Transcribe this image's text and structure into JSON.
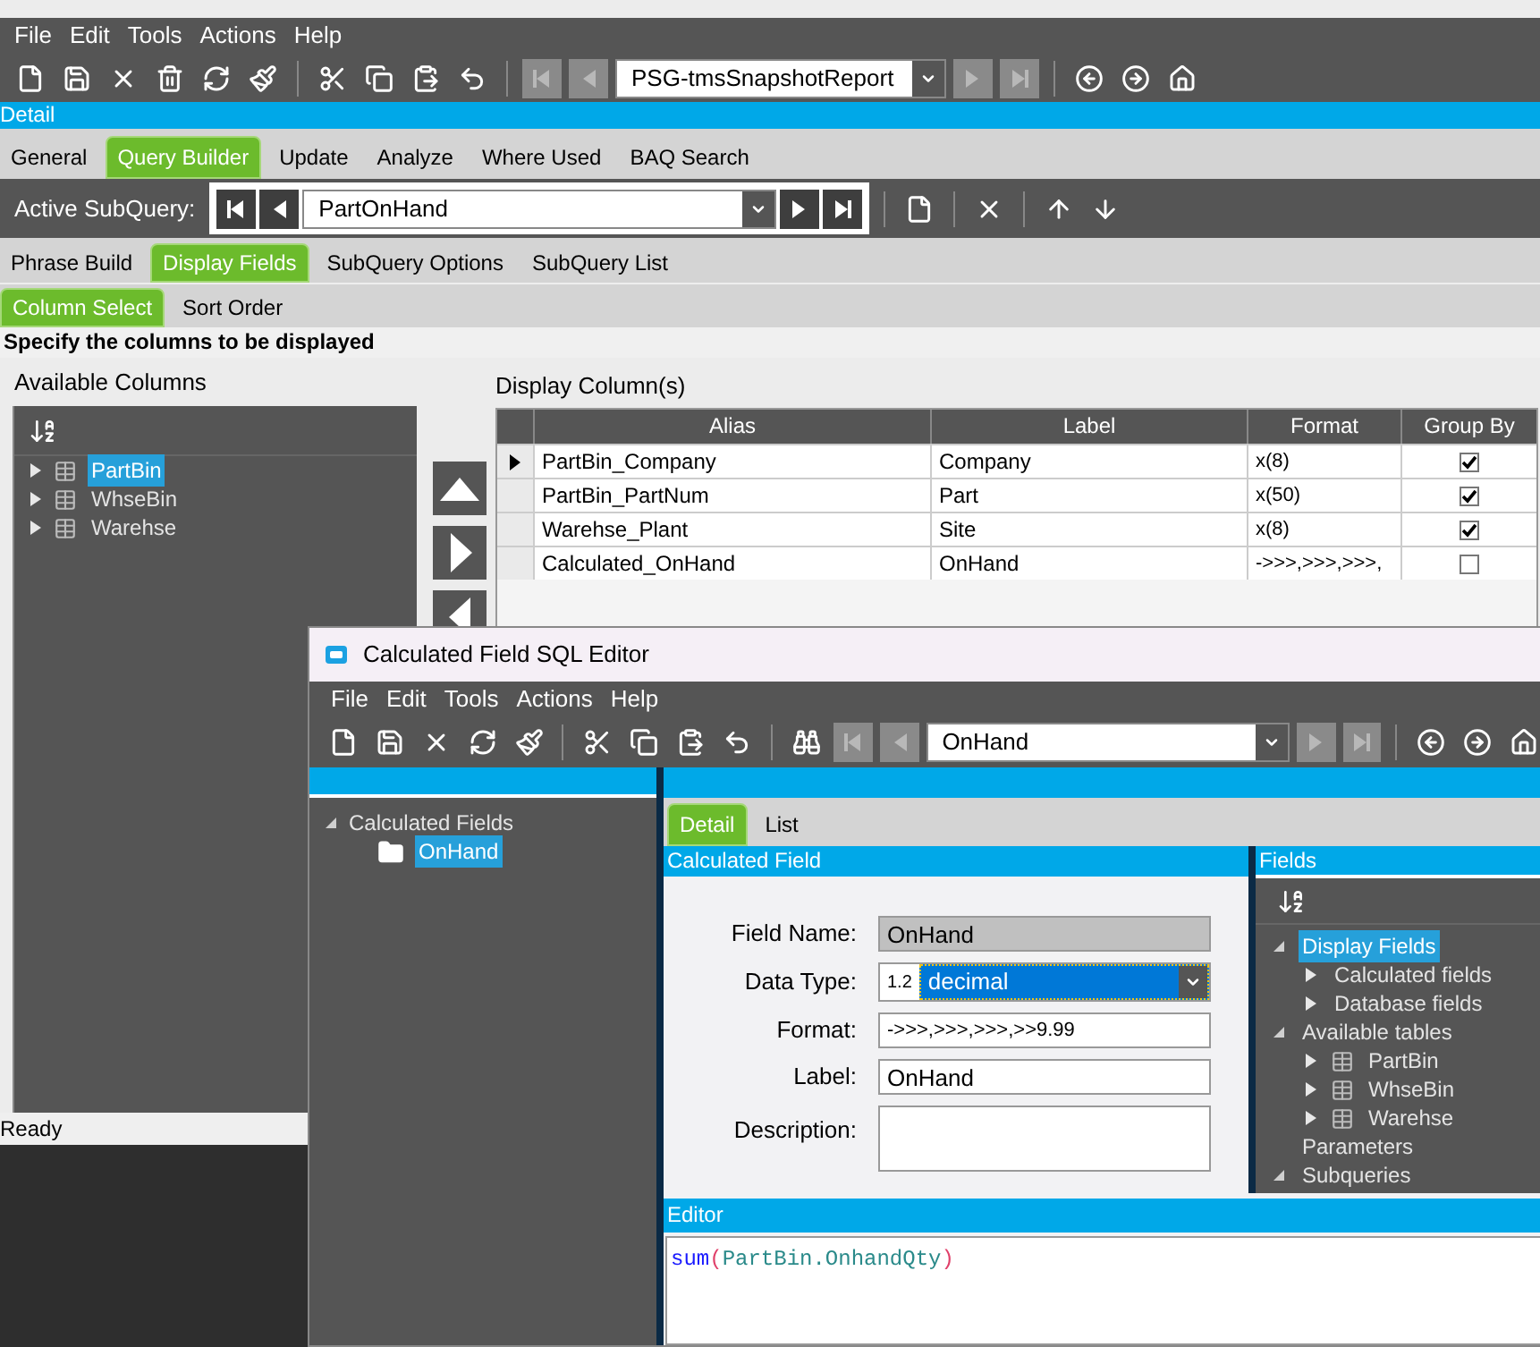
{
  "menu": [
    "File",
    "Edit",
    "Tools",
    "Actions",
    "Help"
  ],
  "toolbar": {
    "record": "PSG-tmsSnapshotReport"
  },
  "panel_title": "Detail",
  "tabs": [
    {
      "label": "General",
      "selected": false
    },
    {
      "label": "Query Builder",
      "selected": true
    },
    {
      "label": "Update",
      "selected": false
    },
    {
      "label": "Analyze",
      "selected": false
    },
    {
      "label": "Where Used",
      "selected": false
    },
    {
      "label": "BAQ Search",
      "selected": false
    }
  ],
  "subquery_bar": {
    "label": "Active SubQuery:",
    "value": "PartOnHand"
  },
  "subtabs": [
    {
      "label": "Phrase Build",
      "selected": false
    },
    {
      "label": "Display Fields",
      "selected": true
    },
    {
      "label": "SubQuery Options",
      "selected": false
    },
    {
      "label": "SubQuery List",
      "selected": false
    }
  ],
  "column_tabs": [
    {
      "label": "Column Select",
      "selected": true
    },
    {
      "label": "Sort Order",
      "selected": false
    }
  ],
  "instruction": "Specify the columns to be displayed",
  "available_columns": {
    "title": "Available Columns",
    "items": [
      {
        "label": "PartBin",
        "selected": true
      },
      {
        "label": "WhseBin",
        "selected": false
      },
      {
        "label": "Warehse",
        "selected": false
      }
    ]
  },
  "display_columns": {
    "title": "Display Column(s)",
    "columns": [
      "Alias",
      "Label",
      "Format",
      "Group By"
    ],
    "rows": [
      {
        "alias": "PartBin_Company",
        "label": "Company",
        "format": "x(8)",
        "group_by": true,
        "current": true
      },
      {
        "alias": "PartBin_PartNum",
        "label": "Part",
        "format": "x(50)",
        "group_by": true,
        "current": false
      },
      {
        "alias": "Warehse_Plant",
        "label": "Site",
        "format": "x(8)",
        "group_by": true,
        "current": false
      },
      {
        "alias": "Calculated_OnHand",
        "label": "OnHand",
        "format": "->>>,>>>,>>>,",
        "group_by": false,
        "current": false
      }
    ]
  },
  "status_bar": "Ready",
  "dialog": {
    "title": "Calculated Field SQL Editor",
    "menu": [
      "File",
      "Edit",
      "Tools",
      "Actions",
      "Help"
    ],
    "record": "OnHand",
    "tree": {
      "label": "Calculated Fields",
      "expanded": true,
      "children": [
        {
          "label": "OnHand",
          "selected": true
        }
      ]
    },
    "tabs": [
      {
        "label": "Detail",
        "selected": true
      },
      {
        "label": "List",
        "selected": false
      }
    ],
    "section": "Calculated Field",
    "form": {
      "field_name": {
        "label": "Field Name:",
        "value": "OnHand",
        "disabled": true
      },
      "data_type": {
        "label": "Data Type:",
        "badge": "1.2",
        "value": "decimal"
      },
      "format": {
        "label": "Format:",
        "value": "->>>,>>>,>>>,>>9.99"
      },
      "field_label": {
        "label": "Label:",
        "value": "OnHand"
      },
      "description": {
        "label": "Description:"
      }
    },
    "fields_panel": {
      "title": "Fields",
      "items": [
        {
          "label": "Display Fields",
          "selected": true,
          "expanded": true,
          "has_children": true,
          "children": [
            {
              "label": "Calculated fields",
              "selected": false,
              "expanded": false,
              "has_children": true,
              "kind": "folder"
            },
            {
              "label": "Database fields",
              "selected": false,
              "expanded": false,
              "has_children": true,
              "kind": "folder"
            }
          ]
        },
        {
          "label": "Available tables",
          "selected": false,
          "expanded": true,
          "has_children": true,
          "children": [
            {
              "label": "PartBin",
              "selected": false,
              "expanded": false,
              "has_children": true,
              "kind": "table"
            },
            {
              "label": "WhseBin",
              "selected": false,
              "expanded": false,
              "has_children": true,
              "kind": "table"
            },
            {
              "label": "Warehse",
              "selected": false,
              "expanded": false,
              "has_children": true,
              "kind": "table"
            }
          ]
        },
        {
          "label": "Parameters",
          "selected": false
        },
        {
          "label": "Subqueries",
          "selected": false,
          "expanded": true,
          "has_children": true
        }
      ]
    },
    "editor": {
      "title": "Editor",
      "code": [
        {
          "text": "sum",
          "kind": "keyword"
        },
        {
          "text": "(",
          "kind": "paren"
        },
        {
          "text": "PartBin.OnhandQty",
          "kind": "identifier"
        },
        {
          "text": ")",
          "kind": "paren"
        }
      ]
    }
  }
}
